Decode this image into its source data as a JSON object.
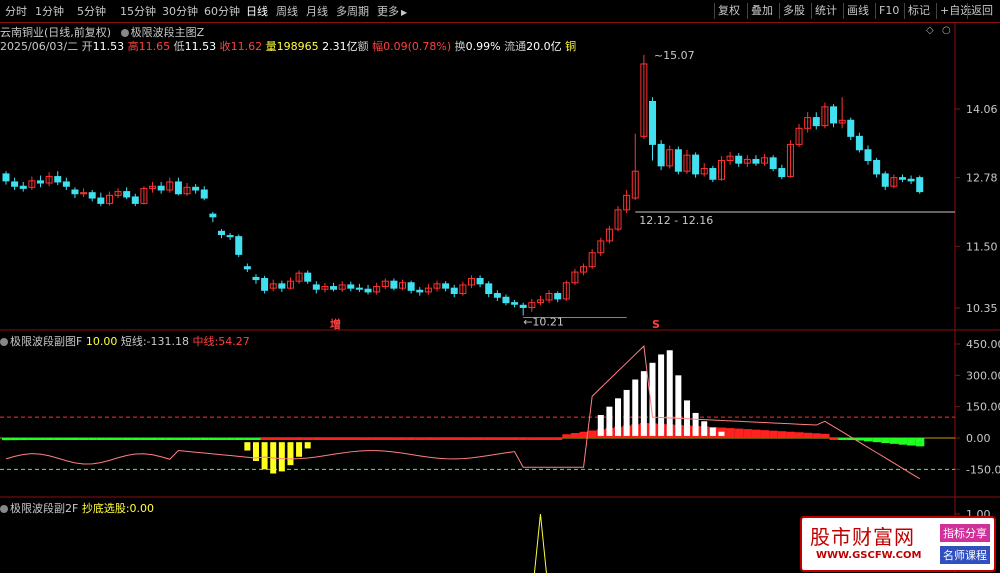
{
  "toolbar": {
    "periods": [
      "分时",
      "1分钟",
      "5分钟",
      "15分钟",
      "30分钟",
      "60分钟",
      "日线",
      "周线",
      "月线",
      "多周期",
      "更多"
    ],
    "more_arrow": "▶",
    "tools": [
      "复权",
      "叠加",
      "多股",
      "统计",
      "画线",
      "F10",
      "标记",
      "+自选",
      "返回"
    ]
  },
  "stock": {
    "name": "云南铜业(日线,前复权)",
    "formula": "极限波段主图Z"
  },
  "quote": {
    "date": "2025/06/03/二",
    "open_label": "开",
    "open": "11.53",
    "high_label": "高",
    "high": "11.65",
    "low_label": "低",
    "low": "11.53",
    "close_label": "收",
    "close": "11.62",
    "vol_label": "量",
    "vol": "198965",
    "amt_label": "额",
    "amt": "2.31亿",
    "chg_label": "幅",
    "chg": "0.09(0.78%)",
    "turn_label": "换",
    "turn": "0.99%",
    "float_label": "流通",
    "float": "20.0亿",
    "tag": "铜"
  },
  "main_axis": [
    "14.06",
    "12.78",
    "11.50",
    "10.35"
  ],
  "annotations": {
    "high": "15.07",
    "low": "10.21",
    "range": "12.12 - 12.16",
    "mark_zeng": "增",
    "mark_s": "S"
  },
  "ind1": {
    "name": "极限波段副图F",
    "v1_label": "",
    "v1": "10.00",
    "v2_label": "短线:",
    "v2": "-131.18",
    "v3_label": "中线:",
    "v3": "54.27",
    "axis": [
      "450.00",
      "300.00",
      "150.00",
      "0.00",
      "-150.00"
    ]
  },
  "ind2": {
    "name": "极限波段副2F",
    "label": "抄底选股:",
    "value": "0.00",
    "axis": [
      "1.00"
    ]
  },
  "watermark": {
    "title": "股市财富网",
    "url": "WWW.GSCFW.COM",
    "tag1": "指标分享",
    "tag2": "名师课程"
  },
  "colors": {
    "up": "#ff3232",
    "down": "#40e0f0",
    "bg": "#000000",
    "frame": "#8a1010"
  },
  "chart_data": {
    "type": "candlestick",
    "price_min": 10.0,
    "price_max": 15.3,
    "candles": [
      [
        12.85,
        12.72,
        12.9,
        12.65
      ],
      [
        12.7,
        12.62,
        12.78,
        12.55
      ],
      [
        12.62,
        12.58,
        12.7,
        12.52
      ],
      [
        12.6,
        12.72,
        12.8,
        12.55
      ],
      [
        12.72,
        12.68,
        12.82,
        12.6
      ],
      [
        12.68,
        12.8,
        12.88,
        12.62
      ],
      [
        12.8,
        12.7,
        12.9,
        12.64
      ],
      [
        12.7,
        12.62,
        12.78,
        12.55
      ],
      [
        12.55,
        12.48,
        12.6,
        12.4
      ],
      [
        12.48,
        12.5,
        12.58,
        12.42
      ],
      [
        12.5,
        12.4,
        12.55,
        12.34
      ],
      [
        12.4,
        12.3,
        12.5,
        12.25
      ],
      [
        12.3,
        12.45,
        12.52,
        12.26
      ],
      [
        12.45,
        12.52,
        12.58,
        12.4
      ],
      [
        12.52,
        12.42,
        12.6,
        12.38
      ],
      [
        12.42,
        12.3,
        12.48,
        12.25
      ],
      [
        12.3,
        12.58,
        12.62,
        12.28
      ],
      [
        12.58,
        12.62,
        12.7,
        12.5
      ],
      [
        12.62,
        12.55,
        12.7,
        12.48
      ],
      [
        12.55,
        12.7,
        12.78,
        12.5
      ],
      [
        12.7,
        12.48,
        12.78,
        12.45
      ],
      [
        12.48,
        12.6,
        12.68,
        12.44
      ],
      [
        12.6,
        12.55,
        12.66,
        12.48
      ],
      [
        12.55,
        12.4,
        12.62,
        12.36
      ],
      [
        12.1,
        12.05,
        12.14,
        11.95
      ],
      [
        11.78,
        11.72,
        11.82,
        11.65
      ],
      [
        11.7,
        11.68,
        11.75,
        11.62
      ],
      [
        11.68,
        11.35,
        11.72,
        11.3
      ],
      [
        11.12,
        11.08,
        11.18,
        11.02
      ],
      [
        10.92,
        10.88,
        10.98,
        10.8
      ],
      [
        10.9,
        10.68,
        10.95,
        10.62
      ],
      [
        10.72,
        10.8,
        10.88,
        10.66
      ],
      [
        10.8,
        10.72,
        10.86,
        10.65
      ],
      [
        10.72,
        10.85,
        10.92,
        10.7
      ],
      [
        10.85,
        11.0,
        11.05,
        10.8
      ],
      [
        11.0,
        10.85,
        11.05,
        10.8
      ],
      [
        10.78,
        10.7,
        10.85,
        10.62
      ],
      [
        10.7,
        10.75,
        10.82,
        10.64
      ],
      [
        10.75,
        10.7,
        10.82,
        10.66
      ],
      [
        10.7,
        10.78,
        10.85,
        10.65
      ],
      [
        10.78,
        10.72,
        10.84,
        10.66
      ],
      [
        10.72,
        10.7,
        10.8,
        10.65
      ],
      [
        10.7,
        10.65,
        10.78,
        10.6
      ],
      [
        10.65,
        10.75,
        10.82,
        10.6
      ],
      [
        10.75,
        10.85,
        10.9,
        10.7
      ],
      [
        10.85,
        10.72,
        10.9,
        10.68
      ],
      [
        10.72,
        10.82,
        10.88,
        10.68
      ],
      [
        10.82,
        10.68,
        10.86,
        10.62
      ],
      [
        10.68,
        10.65,
        10.74,
        10.58
      ],
      [
        10.65,
        10.72,
        10.8,
        10.6
      ],
      [
        10.72,
        10.8,
        10.86,
        10.66
      ],
      [
        10.8,
        10.72,
        10.85,
        10.66
      ],
      [
        10.72,
        10.62,
        10.78,
        10.55
      ],
      [
        10.62,
        10.78,
        10.84,
        10.58
      ],
      [
        10.78,
        10.9,
        10.96,
        10.72
      ],
      [
        10.9,
        10.8,
        10.96,
        10.74
      ],
      [
        10.8,
        10.62,
        10.85,
        10.55
      ],
      [
        10.62,
        10.55,
        10.68,
        10.48
      ],
      [
        10.55,
        10.45,
        10.6,
        10.4
      ],
      [
        10.45,
        10.42,
        10.5,
        10.36
      ],
      [
        10.4,
        10.36,
        10.45,
        10.21
      ],
      [
        10.36,
        10.45,
        10.52,
        10.28
      ],
      [
        10.45,
        10.5,
        10.58,
        10.4
      ],
      [
        10.5,
        10.62,
        10.68,
        10.44
      ],
      [
        10.62,
        10.52,
        10.66,
        10.46
      ],
      [
        10.52,
        10.82,
        10.86,
        10.48
      ],
      [
        10.82,
        11.02,
        11.08,
        10.78
      ],
      [
        11.02,
        11.12,
        11.18,
        10.96
      ],
      [
        11.12,
        11.38,
        11.45,
        11.08
      ],
      [
        11.38,
        11.6,
        11.66,
        11.32
      ],
      [
        11.6,
        11.82,
        11.88,
        11.55
      ],
      [
        11.82,
        12.18,
        12.25,
        11.78
      ],
      [
        12.18,
        12.45,
        12.55,
        12.12
      ],
      [
        12.4,
        12.9,
        13.6,
        12.36
      ],
      [
        13.55,
        14.9,
        15.07,
        13.5
      ],
      [
        14.2,
        13.4,
        14.28,
        13.1
      ],
      [
        13.4,
        13.0,
        13.48,
        12.92
      ],
      [
        13.0,
        13.3,
        13.38,
        12.95
      ],
      [
        13.3,
        12.9,
        13.36,
        12.84
      ],
      [
        12.9,
        13.2,
        13.3,
        12.85
      ],
      [
        13.2,
        12.85,
        13.25,
        12.78
      ],
      [
        12.85,
        12.95,
        13.05,
        12.8
      ],
      [
        12.95,
        12.75,
        13.0,
        12.7
      ],
      [
        12.75,
        13.1,
        13.18,
        12.72
      ],
      [
        13.1,
        13.18,
        13.26,
        13.02
      ],
      [
        13.18,
        13.05,
        13.24,
        12.98
      ],
      [
        13.05,
        13.12,
        13.2,
        12.98
      ],
      [
        13.12,
        13.05,
        13.2,
        13.0
      ],
      [
        13.05,
        13.15,
        13.22,
        13.0
      ],
      [
        13.15,
        12.95,
        13.2,
        12.9
      ],
      [
        12.95,
        12.8,
        13.02,
        12.75
      ],
      [
        12.8,
        13.4,
        13.48,
        12.78
      ],
      [
        13.4,
        13.7,
        13.78,
        13.35
      ],
      [
        13.7,
        13.9,
        14.0,
        13.62
      ],
      [
        13.9,
        13.75,
        14.0,
        13.68
      ],
      [
        13.75,
        14.1,
        14.18,
        13.7
      ],
      [
        14.1,
        13.8,
        14.15,
        13.72
      ],
      [
        13.8,
        13.85,
        14.28,
        13.7
      ],
      [
        13.85,
        13.55,
        13.9,
        13.48
      ],
      [
        13.55,
        13.3,
        13.62,
        13.25
      ],
      [
        13.3,
        13.1,
        13.38,
        13.02
      ],
      [
        13.1,
        12.85,
        13.15,
        12.78
      ],
      [
        12.85,
        12.62,
        12.9,
        12.55
      ],
      [
        12.62,
        12.78,
        12.84,
        12.58
      ],
      [
        12.78,
        12.75,
        12.84,
        12.7
      ],
      [
        12.75,
        12.72,
        12.82,
        12.66
      ],
      [
        12.78,
        12.52,
        12.82,
        12.48
      ]
    ],
    "hline": 12.14,
    "low_line": 10.21
  }
}
